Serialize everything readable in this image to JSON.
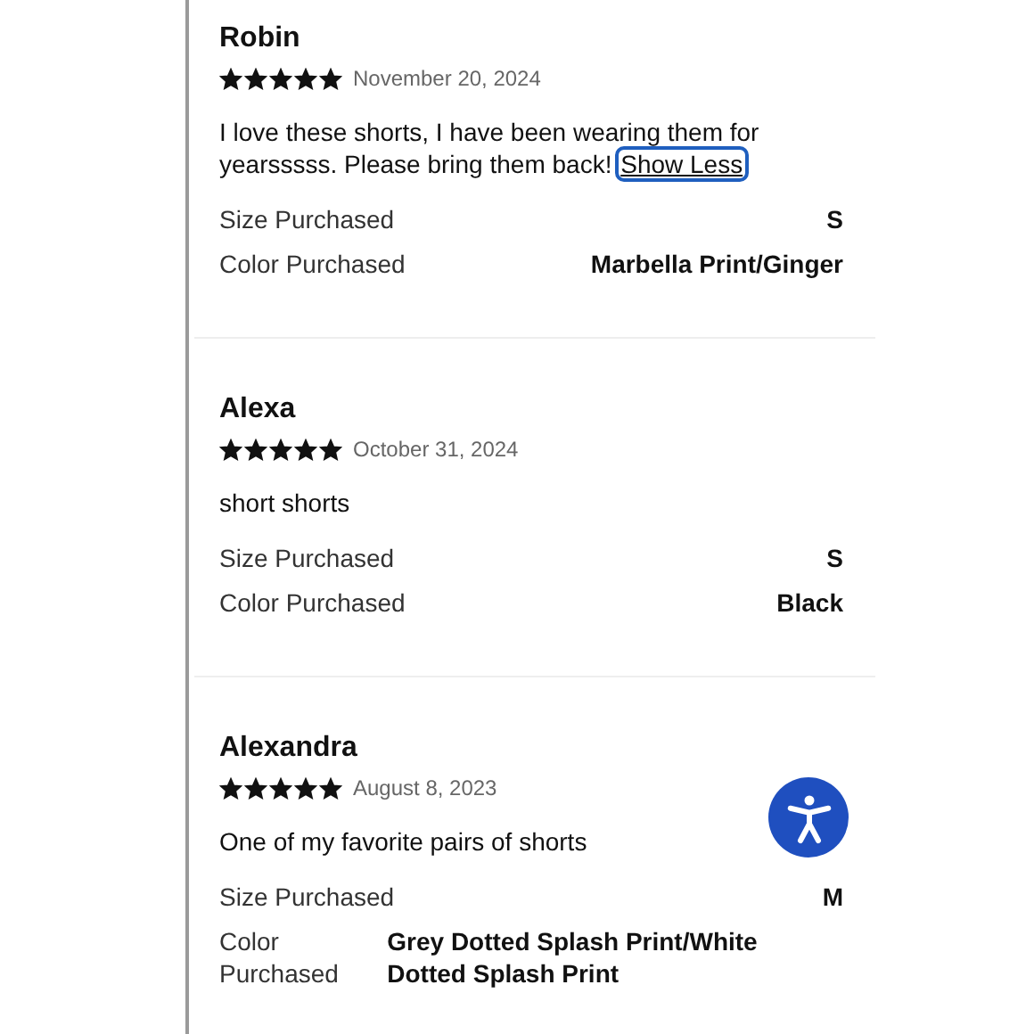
{
  "reviews": [
    {
      "name": "Robin",
      "stars": 5,
      "date": "November 20, 2024",
      "text": "I love these shorts, I have been wearing them for yearsssss. Please bring them back!",
      "link": "Show Less",
      "details": [
        {
          "label": "Size Purchased",
          "value": "S"
        },
        {
          "label": "Color Purchased",
          "value": "Marbella Print/Ginger"
        }
      ]
    },
    {
      "name": "Alexa",
      "stars": 5,
      "date": "October 31, 2024",
      "text": "short shorts",
      "details": [
        {
          "label": "Size Purchased",
          "value": "S"
        },
        {
          "label": "Color Purchased",
          "value": "Black"
        }
      ]
    },
    {
      "name": "Alexandra",
      "stars": 5,
      "date": "August 8, 2023",
      "text": "One of my favorite pairs of shorts",
      "details": [
        {
          "label": "Size Purchased",
          "value": "M"
        },
        {
          "label": "Color Purchased",
          "value": "Grey Dotted Splash Print/White Dotted Splash Print"
        }
      ]
    }
  ]
}
